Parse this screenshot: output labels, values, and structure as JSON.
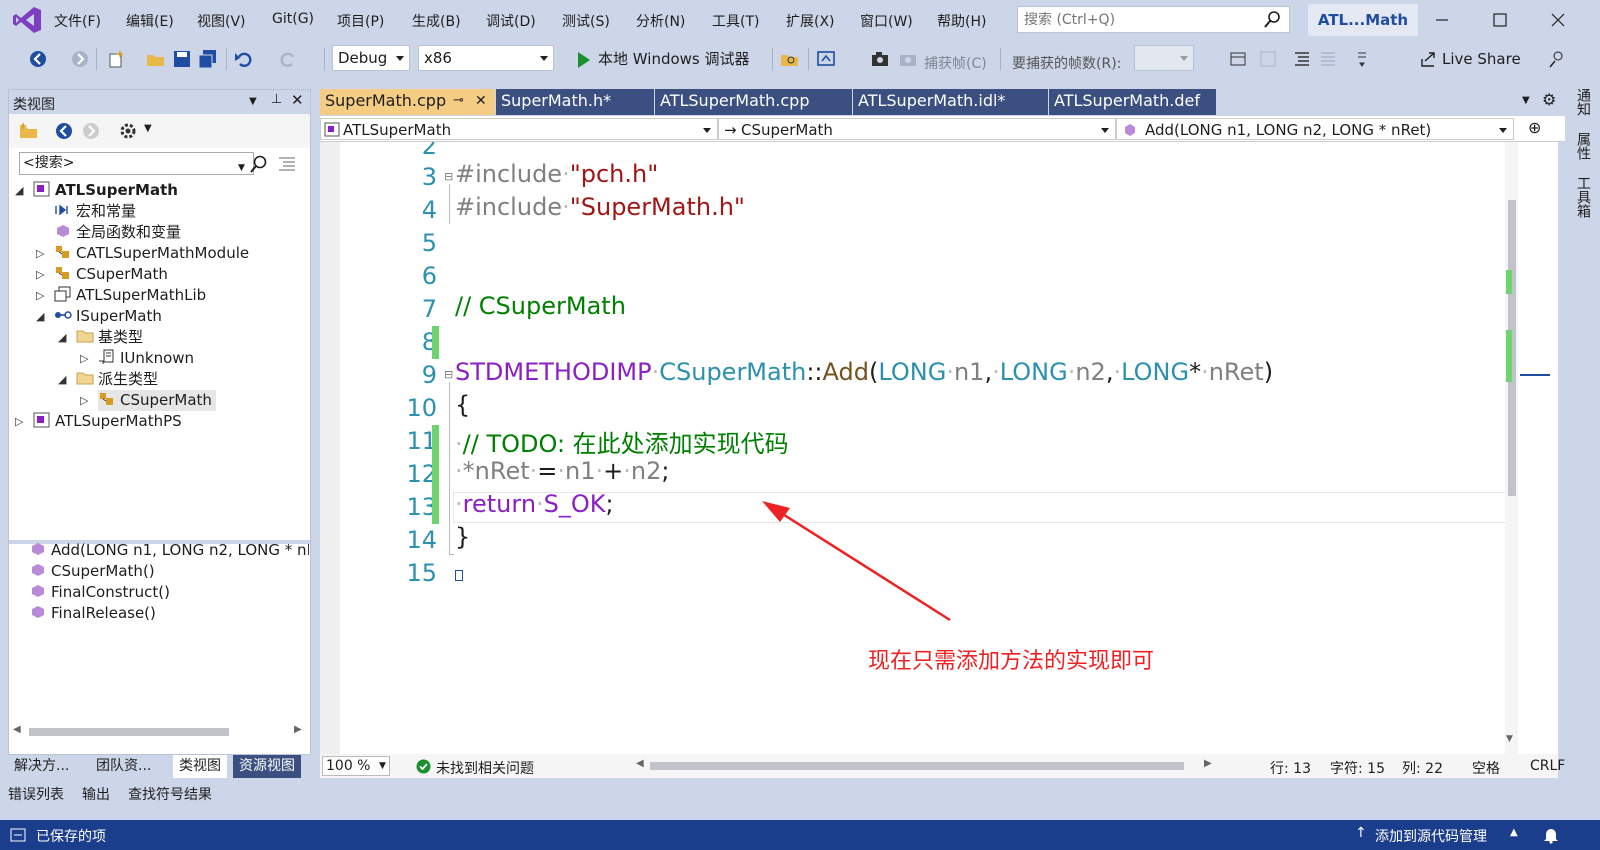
{
  "menu": {
    "items": [
      "文件(F)",
      "编辑(E)",
      "视图(V)",
      "Git(G)",
      "项目(P)",
      "生成(B)",
      "调试(D)",
      "测试(S)",
      "分析(N)",
      "工具(T)",
      "扩展(X)",
      "窗口(W)",
      "帮助(H)"
    ]
  },
  "search": {
    "placeholder": "搜索 (Ctrl+Q)"
  },
  "solution_name": "ATL...Math",
  "toolbar": {
    "config": "Debug",
    "platform": "x86",
    "run_label": "本地 Windows 调试器",
    "capture_frame": "捕获帧(C)",
    "frames_label": "要捕获的帧数(R):",
    "live_share": "Live Share"
  },
  "class_view": {
    "title": "类视图",
    "search_placeholder": "<搜索>",
    "tree": [
      {
        "label": "ATLSuperMath",
        "bold": true
      },
      {
        "label": "宏和常量"
      },
      {
        "label": "全局函数和变量"
      },
      {
        "label": "CATLSuperMathModule"
      },
      {
        "label": "CSuperMath"
      },
      {
        "label": "ATLSuperMathLib"
      },
      {
        "label": "ISuperMath"
      },
      {
        "label": "基类型"
      },
      {
        "label": "IUnknown"
      },
      {
        "label": "派生类型"
      },
      {
        "label": "CSuperMath"
      },
      {
        "label": "ATLSuperMathPS"
      }
    ],
    "members": [
      "Add(LONG n1, LONG n2, LONG * nR",
      "CSuperMath()",
      "FinalConstruct()",
      "FinalRelease()"
    ],
    "bottom_tabs": [
      "解决方...",
      "团队资...",
      "类视图",
      "资源视图"
    ]
  },
  "doc_tabs": [
    "SuperMath.cpp",
    "SuperMath.h*",
    "ATLSuperMath.cpp",
    "ATLSuperMath.idl*",
    "ATLSuperMath.def"
  ],
  "nav": {
    "project": "ATLSuperMath",
    "class": "CSuperMath",
    "member": "Add(LONG n1, LONG n2, LONG * nRet)"
  },
  "code": {
    "line_numbers": [
      "2",
      "3",
      "4",
      "5",
      "6",
      "7",
      "8",
      "9",
      "10",
      "11",
      "12",
      "13",
      "14",
      "15"
    ],
    "l3_kw": "#include",
    "l3_str": "\"pch.h\"",
    "l4_kw": "#include",
    "l4_str": "\"SuperMath.h\"",
    "l7": "// CSuperMath",
    "l9_macro": "STDMETHODIMP",
    "l9_class": "CSuperMath",
    "l9_fn": "Add",
    "l9_type": "LONG",
    "l9_p1": "n1",
    "l9_p2": "n2",
    "l9_p3": "nRet",
    "l10": "{",
    "l11": "// TODO: 在此处添加实现代码",
    "l12_var": "*nRet",
    "l12_a": "n1",
    "l12_b": "n2",
    "l13_kw": "return",
    "l13_val": "S_OK",
    "l14": "}"
  },
  "annotation": "现在只需添加方法的实现即可",
  "editor_status": {
    "zoom": "100 %",
    "issues": "未找到相关问题",
    "line": "行: 13",
    "char": "字符: 15",
    "col": "列: 22",
    "ws": "空格",
    "eol": "CRLF"
  },
  "right_rail": [
    "通知",
    "属性",
    "工具箱"
  ],
  "output_tabs": [
    "错误列表",
    "输出",
    "查找符号结果"
  ],
  "statusbar": {
    "left": "已保存的项",
    "right": "添加到源代码管理"
  },
  "colors": {
    "accent": "#1b3e8c",
    "active_tab": "#f5cc84",
    "inactive_tab": "#3b4f81",
    "annotation": "#ee2222"
  }
}
